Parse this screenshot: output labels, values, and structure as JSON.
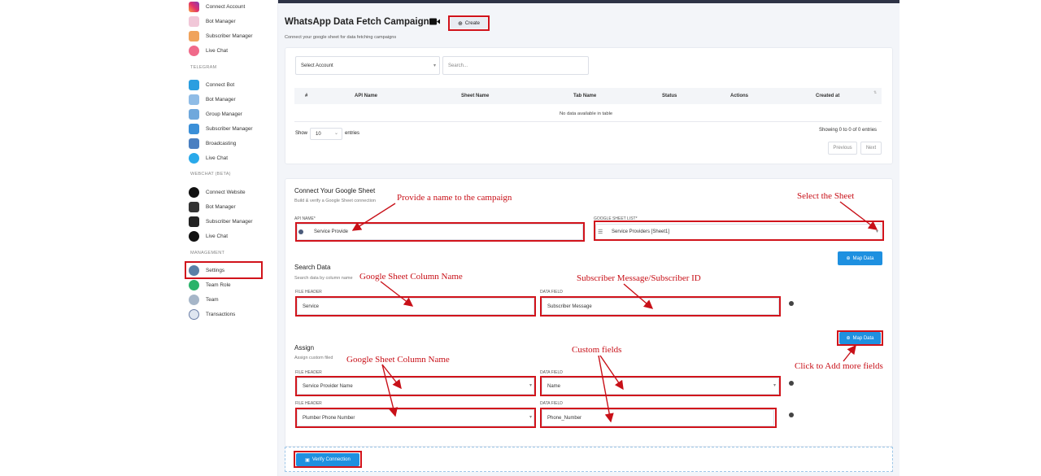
{
  "sidebar": {
    "instagram": {
      "connect_account": "Connect Account",
      "bot_manager": "Bot Manager",
      "subscriber_manager": "Subscriber Manager",
      "live_chat": "Live Chat"
    },
    "telegram": {
      "heading": "TELEGRAM",
      "connect_bot": "Connect Bot",
      "bot_manager": "Bot Manager",
      "group_manager": "Group Manager",
      "subscriber_manager": "Subscriber Manager",
      "broadcasting": "Broadcasting",
      "live_chat": "Live Chat"
    },
    "webchat": {
      "heading": "WEBCHAT (BETA)",
      "connect_website": "Connect Website",
      "bot_manager": "Bot Manager",
      "subscriber_manager": "Subscriber Manager",
      "live_chat": "Live Chat"
    },
    "management": {
      "heading": "MANAGEMENT",
      "settings": "Settings",
      "team_role": "Team Role",
      "team": "Team",
      "transactions": "Transactions"
    }
  },
  "header": {
    "title": "WhatsApp Data Fetch Campaigns",
    "create_label": "Create",
    "subtitle": "Connect your google sheet for data fetching campaigns"
  },
  "table": {
    "select_account": "Select Account",
    "search_placeholder": "Search...",
    "columns": [
      "#",
      "API Name",
      "Sheet Name",
      "Tab Name",
      "Status",
      "Actions",
      "Created at"
    ],
    "empty": "No data available in table",
    "show_label": "Show",
    "show_value": "10",
    "entries_label": "entries",
    "info": "Showing 0 to 0 of 0 entries",
    "previous": "Previous",
    "next": "Next"
  },
  "form": {
    "title": "Connect Your Google Sheet",
    "subtitle": "Build & verify a Google Sheet connection",
    "api_name_label": "API NAME*",
    "api_name_value": "Service Provide",
    "sheet_list_label": "GOOGLE SHEET LIST*",
    "sheet_list_value": "Service Providers [Sheet1]",
    "map_data": "Map Data",
    "search": {
      "title": "Search Data",
      "subtitle": "Search data by column name",
      "file_header_label": "FILE HEADER",
      "file_header_value": "Service",
      "data_field_label": "DATA FIELD",
      "data_field_value": "Subscriber Message"
    },
    "assign": {
      "title": "Assign",
      "subtitle": "Assign custom filed",
      "rows": [
        {
          "file_header_label": "FILE HEADER",
          "file_header_value": "Service Provider Name",
          "data_field_label": "DATA FIELD",
          "data_field_value": "Name"
        },
        {
          "file_header_label": "FILE HEADER",
          "file_header_value": "Plumber Phone Number",
          "data_field_label": "DATA FIELD",
          "data_field_value": "Phone_Number"
        }
      ]
    },
    "verify": "Verify Connection"
  },
  "annotations": {
    "provide_name": "Provide a name to the campaign",
    "select_sheet": "Select the Sheet",
    "gs_column_1": "Google Sheet Column Name",
    "subscriber_msg": "Subscriber Message/Subscriber ID",
    "gs_column_2": "Google Sheet Column Name",
    "custom_fields": "Custom fields",
    "add_more": "Click to Add more fields"
  },
  "colors": {
    "accent": "#1e90e0",
    "annotation": "#c81018",
    "dark": "#2e3346"
  }
}
